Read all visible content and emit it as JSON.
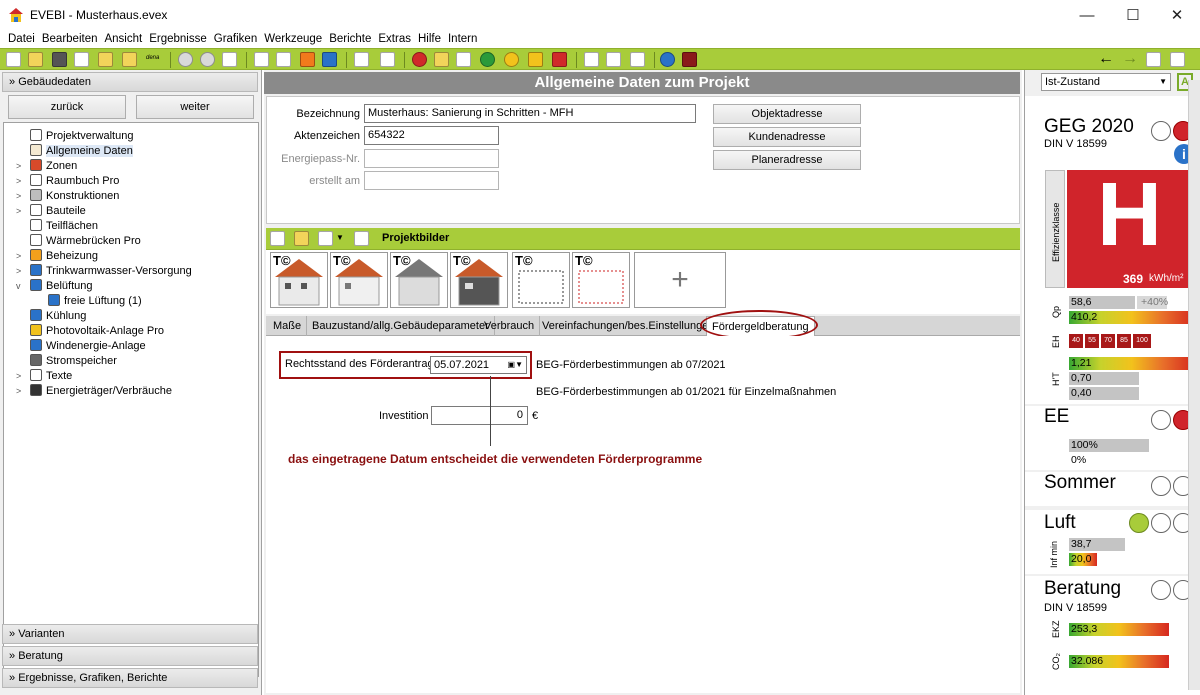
{
  "window": {
    "title": "EVEBI - Musterhaus.evex",
    "minimize": "—",
    "maximize": "☐",
    "close": "✕"
  },
  "menu": [
    "Datei",
    "Bearbeiten",
    "Ansicht",
    "Ergebnisse",
    "Grafiken",
    "Werkzeuge",
    "Berichte",
    "Extras",
    "Hilfe",
    "Intern"
  ],
  "toolbar": {
    "dena_label": "dena",
    "back": "←",
    "forward": "→"
  },
  "left": {
    "section_header": "Gebäudedaten",
    "back_button": "zurück",
    "next_button": "weiter",
    "tree": [
      {
        "label": "Projektverwaltung",
        "expander": "",
        "icon_color": "#ffffff"
      },
      {
        "label": "Allgemeine Daten",
        "expander": "",
        "icon_color": "#f3e9d2"
      },
      {
        "label": "Zonen",
        "expander": ">",
        "icon_color": "#d84a2a"
      },
      {
        "label": "Raumbuch Pro",
        "expander": ">",
        "icon_color": "#ffffff"
      },
      {
        "label": "Konstruktionen",
        "expander": ">",
        "icon_color": "#bdbdbd"
      },
      {
        "label": "Bauteile",
        "expander": ">",
        "icon_color": "#ffffff"
      },
      {
        "label": "Teilflächen",
        "expander": "",
        "icon_color": "#ffffff"
      },
      {
        "label": "Wärmebrücken Pro",
        "expander": "",
        "icon_color": "#ffffff"
      },
      {
        "label": "Beheizung",
        "expander": ">",
        "icon_color": "#f2a01c"
      },
      {
        "label": "Trinkwarmwasser-Versorgung",
        "expander": ">",
        "icon_color": "#2a72c8"
      },
      {
        "label": "Belüftung",
        "expander": "v",
        "icon_color": "#2a72c8"
      },
      {
        "label": "freie Lüftung (1)",
        "expander": "",
        "icon_color": "#2a72c8"
      },
      {
        "label": "Kühlung",
        "expander": "",
        "icon_color": "#2a72c8"
      },
      {
        "label": "Photovoltaik-Anlage Pro",
        "expander": "",
        "icon_color": "#f2c21c"
      },
      {
        "label": "Windenergie-Anlage",
        "expander": "",
        "icon_color": "#2a72c8"
      },
      {
        "label": "Stromspeicher",
        "expander": "",
        "icon_color": "#666666"
      },
      {
        "label": "Texte",
        "expander": ">",
        "icon_color": "#ffffff"
      },
      {
        "label": "Energieträger/Verbräuche",
        "expander": ">",
        "icon_color": "#333333"
      }
    ],
    "bottom_sections": [
      "Varianten",
      "Beratung",
      "Ergebnisse, Grafiken, Berichte"
    ]
  },
  "main": {
    "page_title": "Allgemeine Daten zum Projekt",
    "fields": {
      "bezeichnung_label": "Bezeichnung",
      "bezeichnung_value": "Musterhaus: Sanierung in Schritten - MFH",
      "aktenzeichen_label": "Aktenzeichen",
      "aktenzeichen_value": "654322",
      "energiepass_label": "Energiepass-Nr.",
      "erstellt_label": "erstellt am"
    },
    "address_buttons": [
      "Objektadresse",
      "Kundenadresse",
      "Planeradresse"
    ],
    "projektbilder_label": "Projektbilder",
    "add_image": "+",
    "image_badge": "T©",
    "tabs": [
      "Maße",
      "Bauzustand/allg.Gebäudeparameter",
      "Verbrauch",
      "Vereinfachungen/bes.Einstellungen",
      "Fördergeldberatung"
    ],
    "foerder": {
      "rechtsstand_label": "Rechtsstand des Förderantrags",
      "date": "05.07.2021",
      "beg1": "BEG-Förderbestimmungen ab 07/2021",
      "beg2": "BEG-Förderbestimmungen ab 01/2021 für Einzelmaßnahmen",
      "investition_label": "Investition",
      "investition_value": "0",
      "currency": "€",
      "annotation": "das eingetragene Datum entscheidet die verwendeten Förderprogramme"
    }
  },
  "right": {
    "state_select": "Ist-Zustand",
    "a_badge": "A",
    "geg_title": "GEG 2020",
    "geg_sub": "DIN V 18599",
    "info": "i",
    "effclass_label": "Effizienzklasse",
    "effclass": "H",
    "eff_value": "369",
    "eff_unit": "kWh/m²",
    "qp_label": "Qp",
    "qp_values": [
      "58,6",
      "+40%",
      "410,2"
    ],
    "eh_label": "EH",
    "eh_values": [
      "40",
      "55",
      "70",
      "85",
      "100"
    ],
    "ht_label": "H'T",
    "ht_values": [
      "1,21",
      "0,70",
      "0,40"
    ],
    "ee_title": "EE",
    "ee_values": [
      "100%",
      "0%"
    ],
    "sommer_title": "Sommer",
    "luft_title": "Luft",
    "luft_label": "Inf min",
    "luft_values": [
      "38,7",
      "20,0"
    ],
    "beratung_title": "Beratung",
    "beratung_sub": "DIN V 18599",
    "ekz_label": "EKZ",
    "ekz_value": "253,3",
    "co2_label": "CO₂",
    "co2_value": "32.086",
    "colors": {
      "toolbar": "#a8cc3a",
      "effclass_red": "#d0242b",
      "accent_red": "#a01010"
    }
  }
}
